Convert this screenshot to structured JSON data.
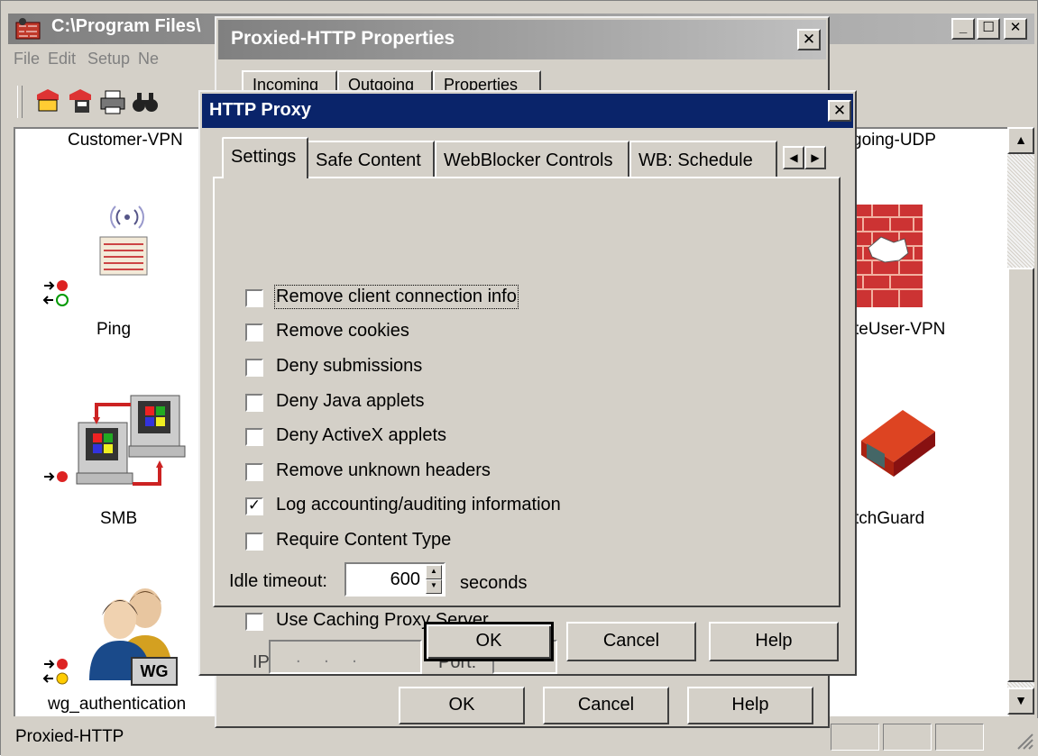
{
  "main_window": {
    "title": "C:\\Program Files\\",
    "menu": [
      "File",
      "Edit",
      "Setup",
      "Ne"
    ],
    "status_text": "Proxied-HTTP",
    "services": {
      "customer_vpn": "Customer-VPN",
      "ping": "Ping",
      "smb": "SMB",
      "wg_authentication": "wg_authentication",
      "outgoing_udp": "going-UDP",
      "remoteuser_vpn": "teUser-VPN",
      "watchguard": "tchGuard",
      "wg_badge": "WG"
    }
  },
  "props_window": {
    "title": "Proxied-HTTP Properties",
    "tabs": [
      "Incoming",
      "Outgoing",
      "Properties"
    ],
    "buttons": {
      "ok": "OK",
      "cancel": "Cancel",
      "help": "Help"
    }
  },
  "proxy_dialog": {
    "title": "HTTP Proxy",
    "tabs": [
      "Settings",
      "Safe Content",
      "WebBlocker Controls",
      "WB: Schedule"
    ],
    "options": [
      {
        "label": "Remove client connection info",
        "checked": false
      },
      {
        "label": "Remove cookies",
        "checked": false
      },
      {
        "label": "Deny submissions",
        "checked": false
      },
      {
        "label": "Deny Java applets",
        "checked": false
      },
      {
        "label": "Deny ActiveX applets",
        "checked": false
      },
      {
        "label": "Remove unknown headers",
        "checked": false
      },
      {
        "label": "Log accounting/auditing information",
        "checked": true
      },
      {
        "label": "Require Content Type",
        "checked": false
      }
    ],
    "idle_timeout_label": "Idle timeout:",
    "idle_timeout_value": "600",
    "idle_timeout_unit": "seconds",
    "caching_label": "Use Caching Proxy Server",
    "caching_checked": false,
    "ip_label": "IP:",
    "ip_value": ". . .",
    "port_label": "Port:",
    "port_value": "",
    "buttons": {
      "ok": "OK",
      "cancel": "Cancel",
      "help": "Help"
    }
  }
}
